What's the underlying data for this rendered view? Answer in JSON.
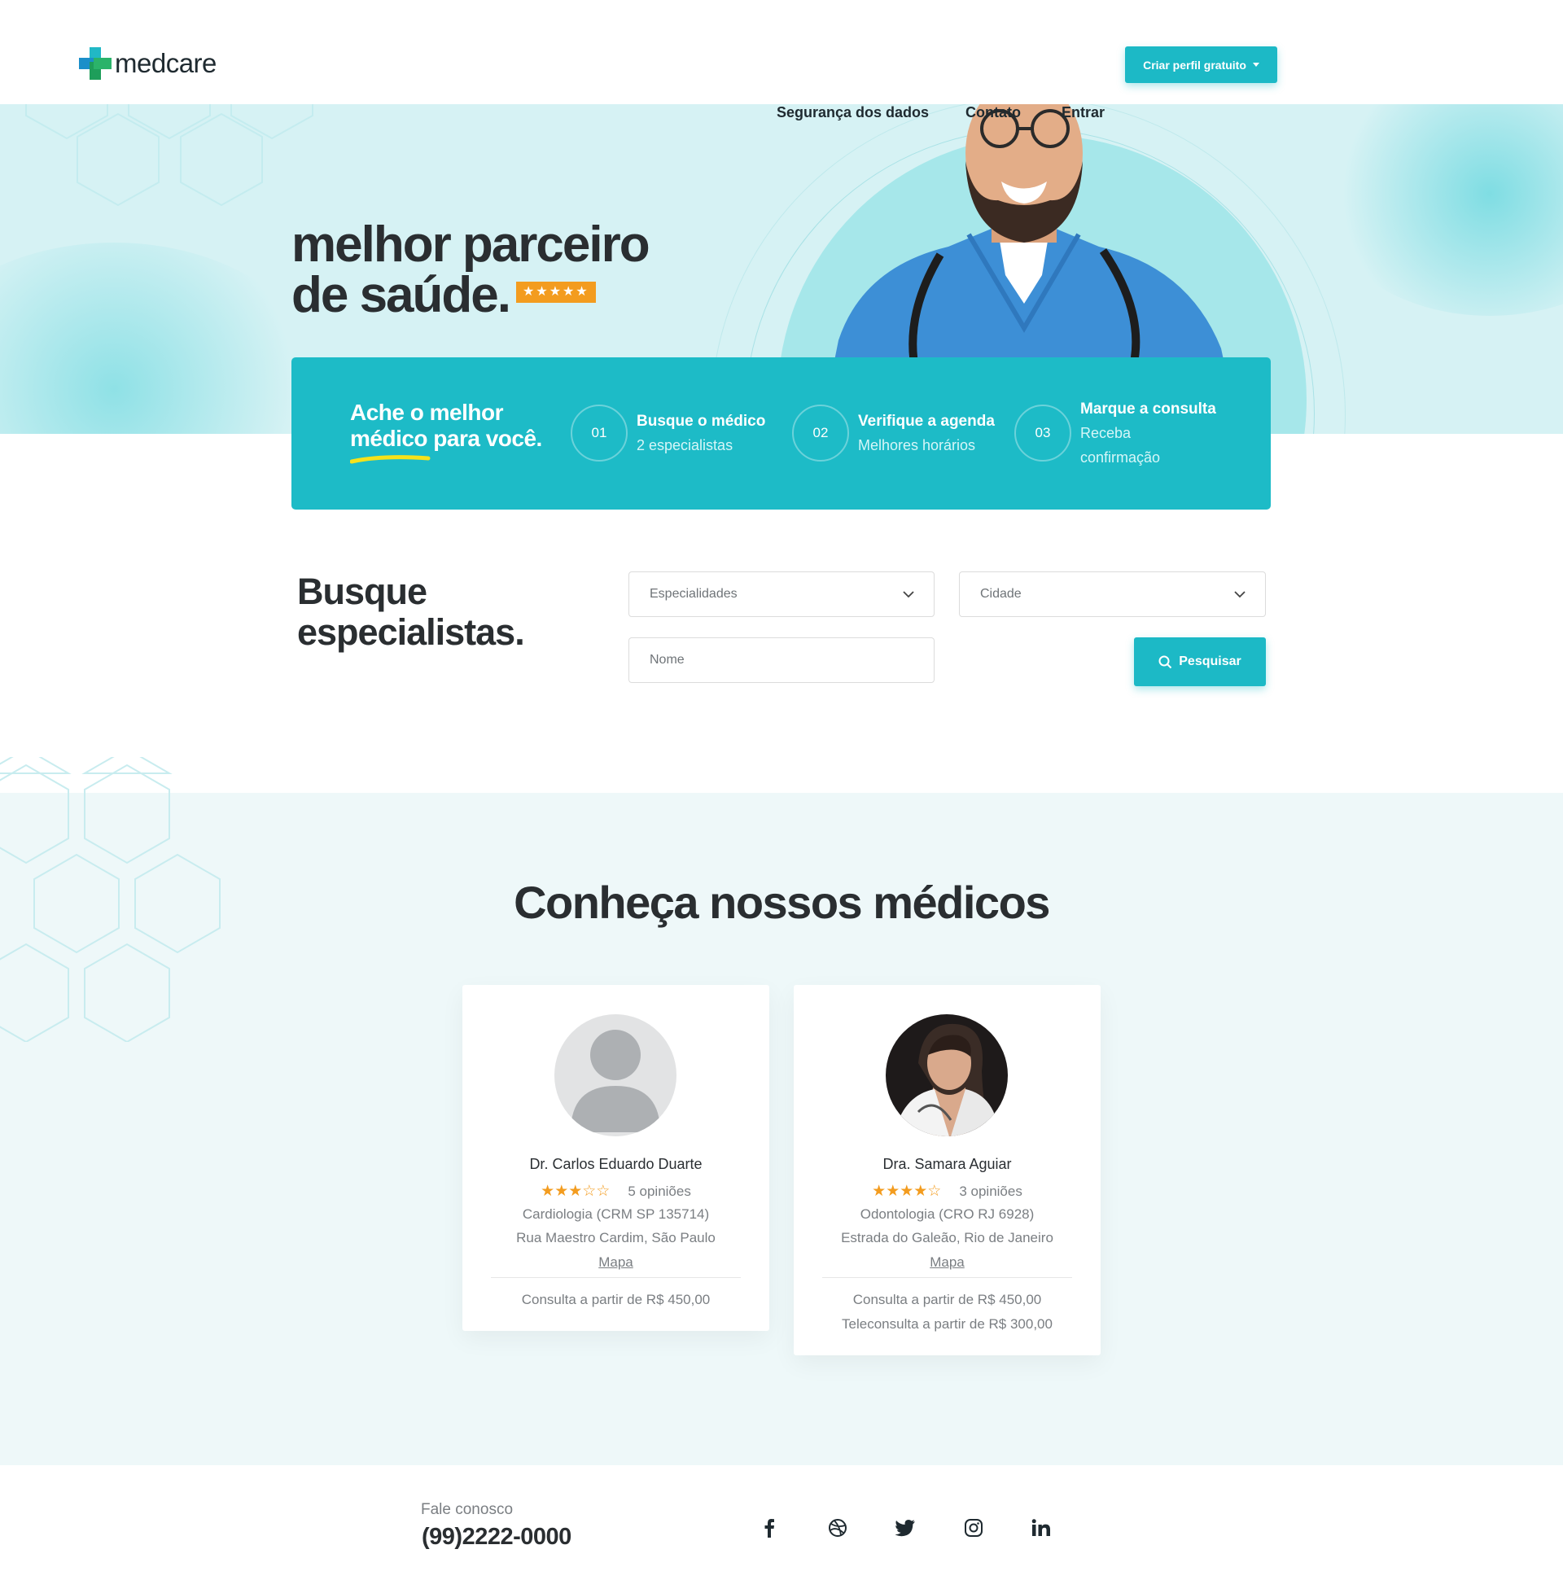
{
  "brand": {
    "name": "medcare",
    "accent": "#1dbbc7",
    "star_color": "#f39c1f"
  },
  "nav": {
    "items": [
      "Segurança dos dados",
      "Contato",
      "Entrar"
    ],
    "cta": "Criar perfil gratuito"
  },
  "hero": {
    "title_line1": "melhor parceiro",
    "title_line2": "de saúde.",
    "badge_stars": "★★★★★"
  },
  "steps": {
    "title_line1": "Ache o melhor",
    "title_line2": "médico para você.",
    "items": [
      {
        "num": "01",
        "title": "Busque o médico",
        "sub1": "2 especialistas",
        "sub2": ""
      },
      {
        "num": "02",
        "title": "Verifique a agenda",
        "sub1": "Melhores horários",
        "sub2": ""
      },
      {
        "num": "03",
        "title": "Marque a consulta",
        "sub1": "Receba",
        "sub2": "confirmação"
      }
    ]
  },
  "search": {
    "title_line1": "Busque",
    "title_line2": "especialistas.",
    "specialty_placeholder": "Especialidades",
    "city_placeholder": "Cidade",
    "name_placeholder": "Nome",
    "button": "Pesquisar"
  },
  "doctors_section": {
    "title": "Conheça nossos médicos",
    "doctors": [
      {
        "name": "Dr. Carlos Eduardo Duarte",
        "rating": 3,
        "stars": "★★★☆☆",
        "reviews": "5 opiniões",
        "specialty": "Cardiologia (CRM SP 135714)",
        "address": "Rua Maestro Cardim, São Paulo",
        "map": "Mapa",
        "price1": "Consulta a partir de R$ 450,00",
        "price2": ""
      },
      {
        "name": "Dra. Samara Aguiar",
        "rating": 4,
        "stars": "★★★★☆",
        "reviews": "3 opiniões",
        "specialty": "Odontologia (CRO RJ 6928)",
        "address": "Estrada do Galeão, Rio de Janeiro",
        "map": "Mapa",
        "price1": "Consulta a partir de R$ 450,00",
        "price2": "Teleconsulta a partir de R$ 300,00"
      }
    ]
  },
  "footer": {
    "label": "Fale conosco",
    "phone": "(99)2222-0000",
    "social": [
      "facebook-icon",
      "dribbble-icon",
      "twitter-icon",
      "instagram-icon",
      "linkedin-icon"
    ]
  }
}
